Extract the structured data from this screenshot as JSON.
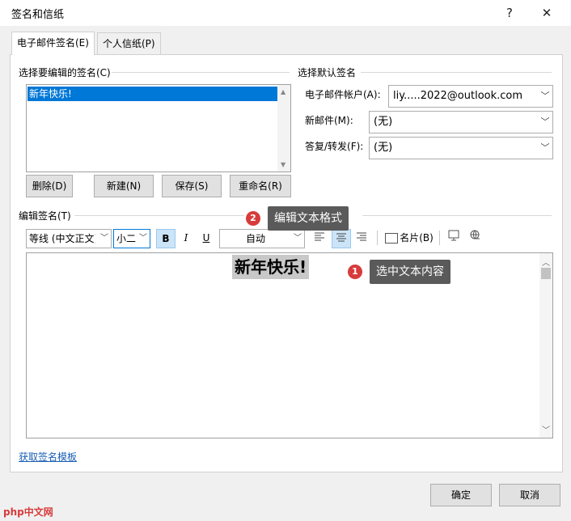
{
  "dialog": {
    "title": "签名和信纸",
    "help": "?",
    "close": "✕"
  },
  "tabs": [
    {
      "label": "电子邮件签名(E)"
    },
    {
      "label": "个人信纸(P)"
    }
  ],
  "select_signature": {
    "label": "选择要编辑的签名(C)",
    "items": [
      "新年快乐!"
    ],
    "buttons": {
      "delete": "删除(D)",
      "new": "新建(N)",
      "save": "保存(S)",
      "rename": "重命名(R)"
    }
  },
  "default_signature": {
    "label": "选择默认签名",
    "account_label": "电子邮件帐户(A):",
    "account_value": "liy.....2022@outlook.com",
    "new_label": "新邮件(M):",
    "new_value": "(无)",
    "reply_label": "答复/转发(F):",
    "reply_value": "(无)"
  },
  "edit": {
    "label": "编辑签名(T)",
    "font": "等线 (中文正文)",
    "size": "小二",
    "bold": "B",
    "italic": "I",
    "underline": "U",
    "color": "自动",
    "business_card": "名片(B)",
    "content": "新年快乐!"
  },
  "annotations": [
    {
      "num": "2",
      "text": "编辑文本格式"
    },
    {
      "num": "1",
      "text": "选中文本内容"
    }
  ],
  "template_link": "获取签名模板",
  "footer": {
    "ok": "确定",
    "cancel": "取消"
  },
  "watermark": "php中文网",
  "colors": {
    "selection": "#0078d7",
    "callout": "#5a5a5a",
    "badge": "#d83b3b"
  }
}
